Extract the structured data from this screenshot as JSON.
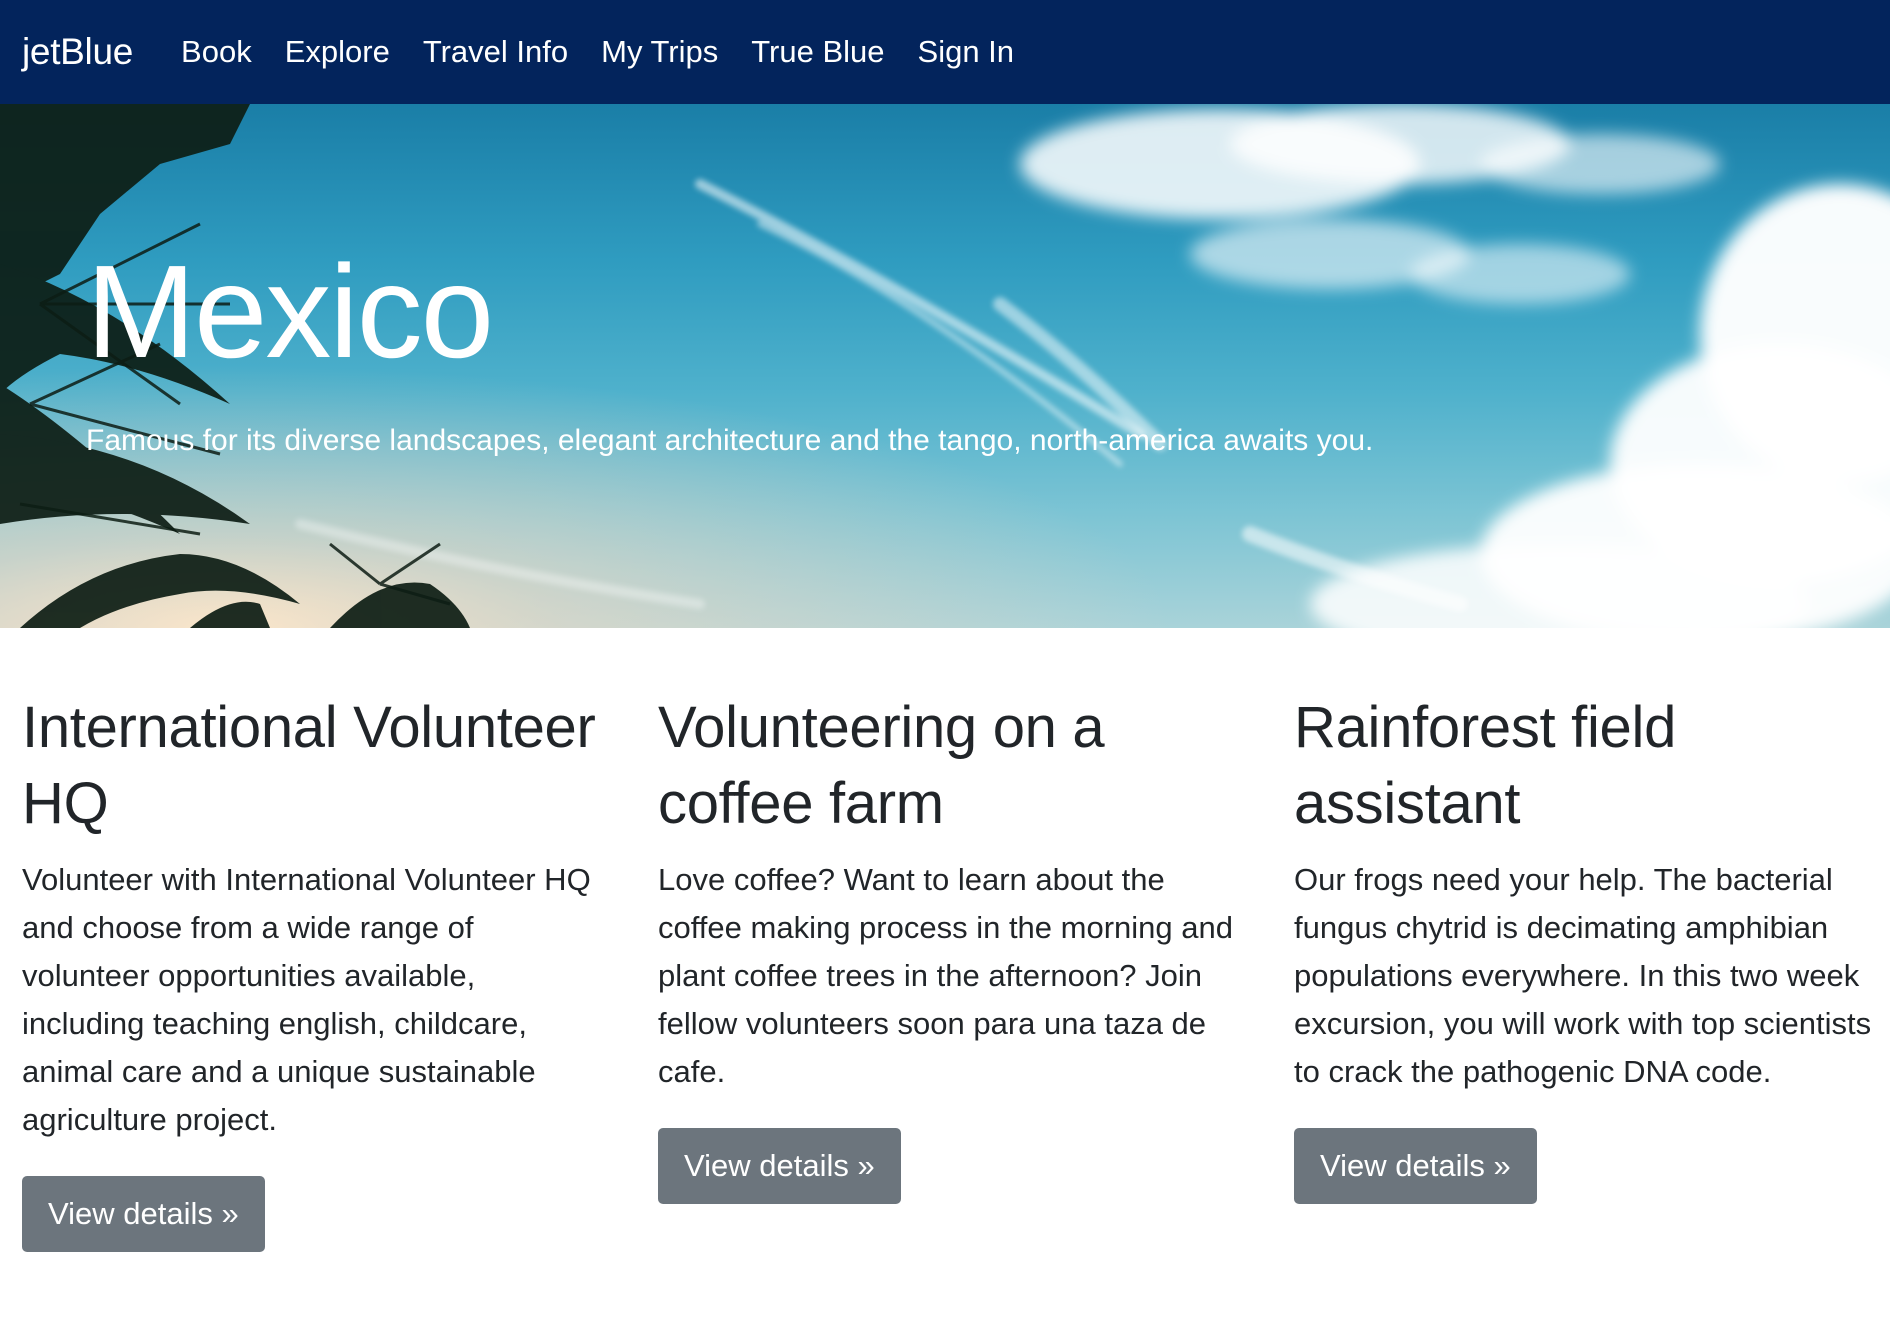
{
  "navbar": {
    "brand": "jetBlue",
    "links": [
      {
        "label": "Book"
      },
      {
        "label": "Explore"
      },
      {
        "label": "Travel Info"
      },
      {
        "label": "My Trips"
      },
      {
        "label": "True Blue"
      },
      {
        "label": "Sign In"
      }
    ]
  },
  "hero": {
    "title": "Mexico",
    "subtitle": "Famous for its diverse landscapes, elegant architecture and the tango, north-america awaits you."
  },
  "cards": [
    {
      "title": "International Volunteer HQ",
      "body": "Volunteer with International Volunteer HQ and choose from a wide range of volunteer opportunities available, including teaching english, childcare, animal care and a unique sustainable agriculture project.",
      "button": "View details »"
    },
    {
      "title": "Volunteering on a coffee farm",
      "body": "Love coffee? Want to learn about the coffee making process in the morning and plant coffee trees in the afternoon? Join fellow volunteers soon para una taza de cafe.",
      "button": "View details »"
    },
    {
      "title": "Rainforest field assistant",
      "body": "Our frogs need your help. The bacterial fungus chytrid is decimating amphibian populations everywhere. In this two week excursion, you will work with top scientists to crack the pathogenic DNA code.",
      "button": "View details »"
    }
  ],
  "colors": {
    "navbar_bg": "#03245c",
    "button_bg": "#6c757d",
    "text": "#212529"
  }
}
